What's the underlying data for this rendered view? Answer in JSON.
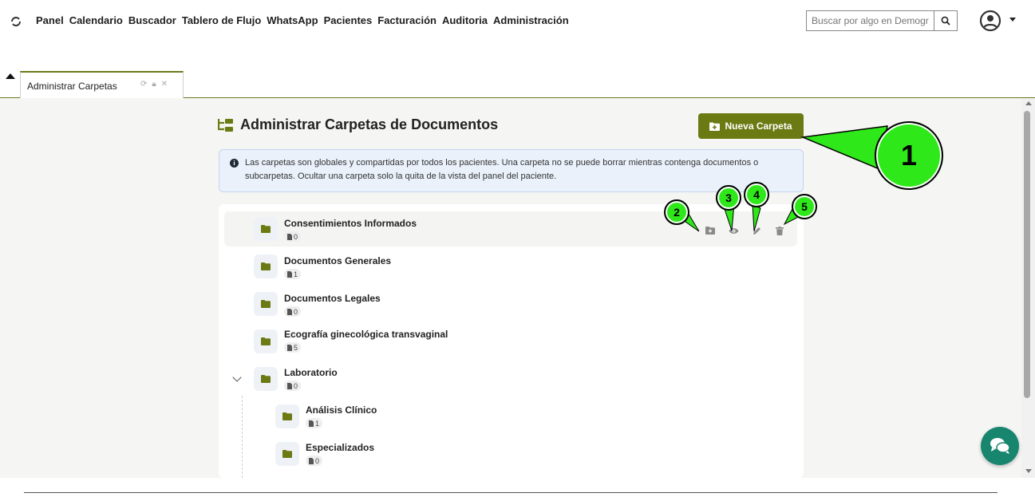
{
  "nav": {
    "items": [
      "Panel",
      "Calendario",
      "Buscador",
      "Tablero de Flujo",
      "WhatsApp",
      "Pacientes",
      "Facturación",
      "Auditoria",
      "Administración"
    ],
    "search_placeholder": "Buscar por algo en Demogr"
  },
  "tab": {
    "label": "Administrar Carpetas"
  },
  "page": {
    "title": "Administrar Carpetas de Documentos",
    "new_folder_label": "Nueva Carpeta",
    "info_text": "Las carpetas son globales y compartidas por todos los pacientes. Una carpeta no se puede borrar mientras contenga documentos o subcarpetas. Ocultar una carpeta solo la quita de la vista del panel del paciente."
  },
  "folders": [
    {
      "name": "Consentimientos Informados",
      "count": "0"
    },
    {
      "name": "Documentos Generales",
      "count": "1"
    },
    {
      "name": "Documentos Legales",
      "count": "0"
    },
    {
      "name": "Ecografía ginecológica transvaginal",
      "count": "5"
    },
    {
      "name": "Laboratorio",
      "count": "0"
    },
    {
      "name": "Análisis Clínico",
      "count": "1"
    },
    {
      "name": "Especializados",
      "count": "0"
    }
  ],
  "callouts": [
    "1",
    "2",
    "3",
    "4",
    "5"
  ],
  "colors": {
    "accent": "#6b7a12",
    "callout": "#2ee81a",
    "chat": "#18856e",
    "info_bg": "#eaf1fb"
  },
  "icons": [
    "refresh-icon",
    "user-circle-icon",
    "search-icon",
    "folder-icon",
    "folder-plus-icon",
    "eye-icon",
    "pencil-icon",
    "trash-icon",
    "file-icon",
    "chat-icon"
  ]
}
